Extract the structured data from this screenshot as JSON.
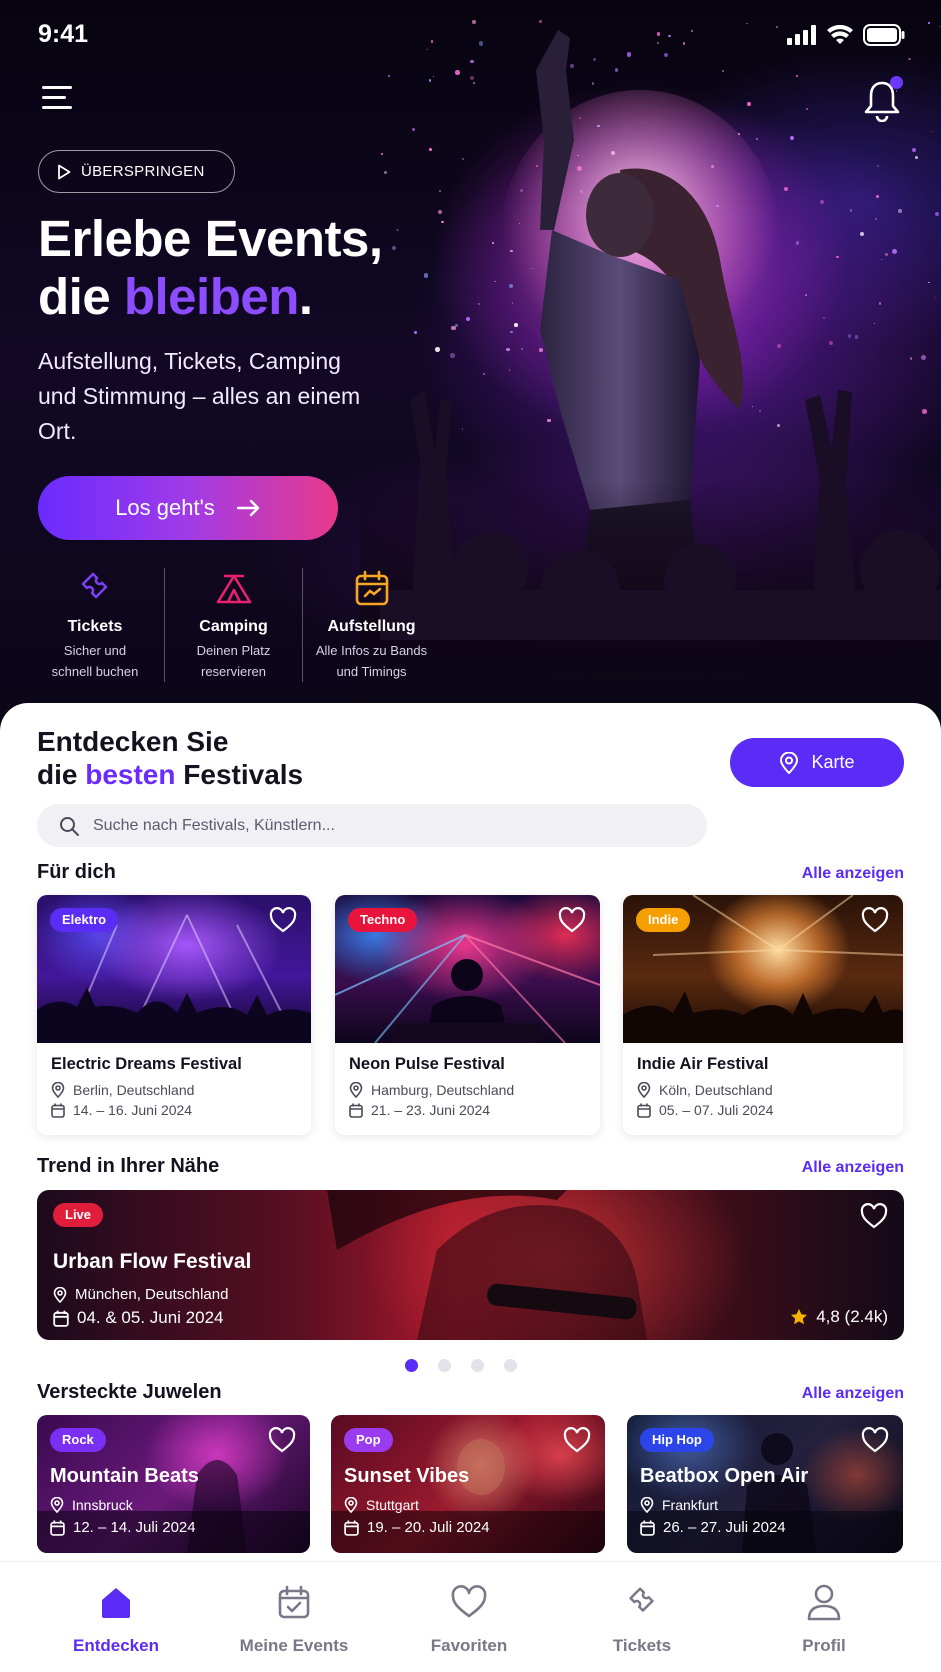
{
  "status_bar": {
    "time": "9:41"
  },
  "hero": {
    "skip_label": "ÜBERSPRINGEN",
    "headline_line1": "Erlebe Events,",
    "headline_line2_prefix": "die ",
    "headline_line2_accent": "bleiben",
    "headline_line2_suffix": ".",
    "subtext": "Aufstellung, Tickets, Camping und Stimmung – alles an einem Ort.",
    "cta_label": "Los geht's",
    "features": [
      {
        "icon": "ticket-icon",
        "title": "Tickets",
        "desc_line1": "Sicher und",
        "desc_line2": "schnell buchen",
        "color": "#7b3ff2"
      },
      {
        "icon": "tent-icon",
        "title": "Camping",
        "desc_line1": "Deinen Platz",
        "desc_line2": "reservieren",
        "color": "#e8206e"
      },
      {
        "icon": "calendar-icon",
        "title": "Aufstellung",
        "desc_line1": "Alle Infos zu Bands",
        "desc_line2": "und Timings",
        "color": "#f5a623"
      }
    ]
  },
  "discover": {
    "title_line1": "Entdecken Sie",
    "title_line2_prefix": "die ",
    "title_line2_accent": "besten",
    "title_line2_suffix": " Festivals",
    "map_label": "Karte",
    "search_placeholder": "Suche nach Festivals, Künstlern..."
  },
  "for_you": {
    "title": "Für dich",
    "see_all": "Alle anzeigen",
    "cards": [
      {
        "tag": "Elektro",
        "tag_color": "#5b2cf5",
        "title": "Electric Dreams Festival",
        "location": "Berlin, Deutschland",
        "date": "14. – 16. Juni 2024"
      },
      {
        "tag": "Techno",
        "tag_color": "#e8143c",
        "title": "Neon Pulse Festival",
        "location": "Hamburg, Deutschland",
        "date": "21. – 23. Juni 2024"
      },
      {
        "tag": "Indie",
        "tag_color": "#f5a000",
        "title": "Indie Air Festival",
        "location": "Köln, Deutschland",
        "date": "05. – 07. Juli 2024"
      }
    ]
  },
  "trending": {
    "title": "Trend in Ihrer Nähe",
    "see_all": "Alle anzeigen",
    "badge": "Live",
    "event_title": "Urban Flow Festival",
    "location": "München, Deutschland",
    "date": "04. & 05. Juni 2024",
    "rating": "4,8 (2.4k)",
    "carousel_pages": 4,
    "carousel_active": 1
  },
  "hidden_gems": {
    "title": "Versteckte Juwelen",
    "see_all": "Alle anzeigen",
    "cards": [
      {
        "tag": "Rock",
        "tag_color": "#7b2ff2",
        "title": "Mountain Beats",
        "location": "Innsbruck",
        "date": "12. – 14. Juli 2024"
      },
      {
        "tag": "Pop",
        "tag_color": "#9b3bf0",
        "title": "Sunset Vibes",
        "location": "Stuttgart",
        "date": "19. – 20. Juli 2024"
      },
      {
        "tag": "Hip Hop",
        "tag_color": "#2b45e8",
        "title": "Beatbox Open Air",
        "location": "Frankfurt",
        "date": "26. – 27. Juli 2024"
      }
    ]
  },
  "tabbar": {
    "tabs": [
      {
        "label": "Entdecken",
        "icon": "home-icon",
        "active": true
      },
      {
        "label": "Meine Events",
        "icon": "calendar-check-icon",
        "active": false
      },
      {
        "label": "Favoriten",
        "icon": "heart-icon",
        "active": false
      },
      {
        "label": "Tickets",
        "icon": "ticket-icon",
        "active": false
      },
      {
        "label": "Profil",
        "icon": "user-icon",
        "active": false
      }
    ]
  },
  "colors": {
    "accent": "#5b2cf5",
    "accent_light": "#8b4dff",
    "live_red": "#e01e3c",
    "star": "#f5b400"
  }
}
